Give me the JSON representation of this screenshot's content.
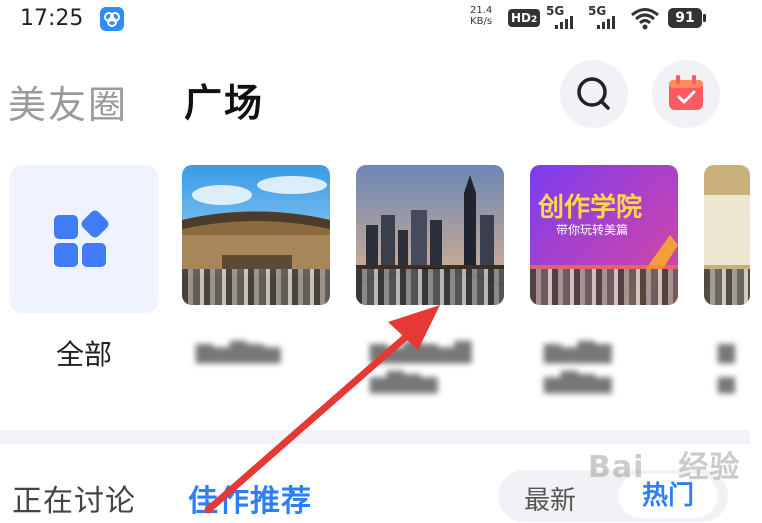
{
  "statusbar": {
    "time": "17:25",
    "net_speed_top": "21.4",
    "net_speed_unit": "KB/s",
    "hd_label": "HD",
    "hd_sub": "2",
    "sim1": "5G",
    "sim2": "5G",
    "battery": "91"
  },
  "header": {
    "tab_meiyouquan": "美友圈",
    "tab_guangchang": "广场"
  },
  "categories": {
    "all_label": "全部"
  },
  "tabs_bottom": {
    "discussing": "正在讨论",
    "recommended": "佳作推荐"
  },
  "sort": {
    "latest": "最新",
    "hot": "热门"
  },
  "tile_overlay_text": {
    "creative_academy_title": "创作学院",
    "creative_academy_sub": "带你玩转美篇"
  },
  "watermark": "Bai du 经验",
  "colors": {
    "accent": "#2d7ff9",
    "arrow": "#e53935"
  }
}
